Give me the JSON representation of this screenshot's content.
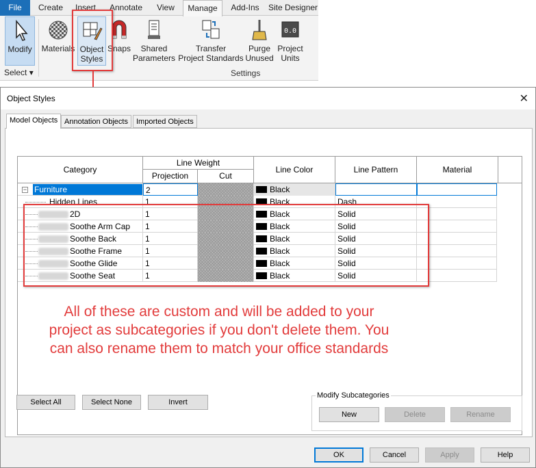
{
  "ribbon": {
    "tabs": [
      "File",
      "Create",
      "Insert",
      "Annotate",
      "View",
      "Manage",
      "Add-Ins",
      "Site Designer"
    ],
    "active_tab": "Manage",
    "buttons": {
      "modify": "Modify",
      "materials": "Materials",
      "object_styles_1": "Object",
      "object_styles_2": "Styles",
      "snaps": "Snaps",
      "shared_params_1": "Shared",
      "shared_params_2": "Parameters",
      "transfer_1": "Transfer",
      "transfer_2": "Project Standards",
      "purge_1": "Purge",
      "purge_2": "Unused",
      "units_1": "Project",
      "units_2": "Units"
    },
    "select_label": "Select",
    "settings_label": "Settings"
  },
  "dialog": {
    "title": "Object Styles",
    "close": "✕",
    "tabs": [
      "Model Objects",
      "Annotation Objects",
      "Imported Objects"
    ],
    "active_tab": "Model Objects",
    "headers": {
      "category": "Category",
      "line_weight": "Line Weight",
      "projection": "Projection",
      "cut": "Cut",
      "line_color": "Line Color",
      "line_pattern": "Line Pattern",
      "material": "Material"
    },
    "rows": [
      {
        "category": "Furniture",
        "projection": "2",
        "color": "Black",
        "pattern": "",
        "material": ""
      },
      {
        "category": "Hidden Lines",
        "projection": "1",
        "color": "Black",
        "pattern": "Dash",
        "material": ""
      },
      {
        "category": "2D",
        "projection": "1",
        "color": "Black",
        "pattern": "Solid",
        "material": ""
      },
      {
        "category": "Soothe Arm Cap",
        "projection": "1",
        "color": "Black",
        "pattern": "Solid",
        "material": ""
      },
      {
        "category": "Soothe Back",
        "projection": "1",
        "color": "Black",
        "pattern": "Solid",
        "material": ""
      },
      {
        "category": "Soothe Frame",
        "projection": "1",
        "color": "Black",
        "pattern": "Solid",
        "material": ""
      },
      {
        "category": "Soothe Glide",
        "projection": "1",
        "color": "Black",
        "pattern": "Solid",
        "material": ""
      },
      {
        "category": "Soothe Seat",
        "projection": "1",
        "color": "Black",
        "pattern": "Solid",
        "material": ""
      }
    ],
    "annotation": "All of these are custom and will be added to your project as subcategories if you don't delete them. You can also rename them to match your office standards",
    "select_buttons": {
      "select_all": "Select All",
      "select_none": "Select None",
      "invert": "Invert"
    },
    "modify_subcategories": {
      "label": "Modify Subcategories",
      "new": "New",
      "delete": "Delete",
      "rename": "Rename"
    },
    "footer": {
      "ok": "OK",
      "cancel": "Cancel",
      "apply": "Apply",
      "help": "Help"
    }
  },
  "colors": {
    "accent": "#1c6fb8",
    "annotation_red": "#e23b3b",
    "selection": "#0078d7"
  }
}
